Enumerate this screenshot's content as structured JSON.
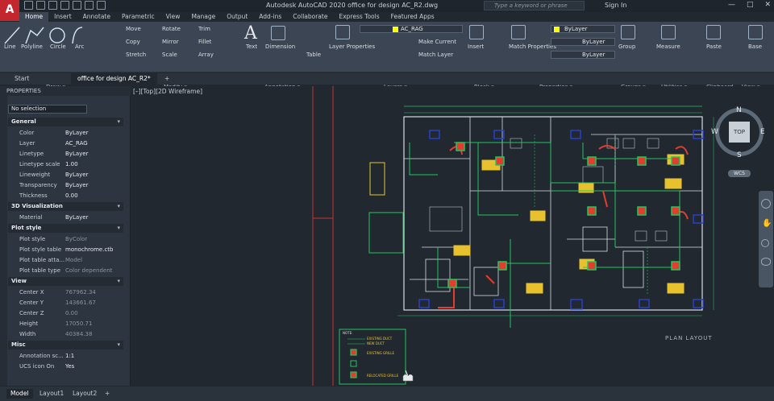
{
  "window": {
    "title": "Autodesk AutoCAD 2020   office for design AC_R2.dwg",
    "search_placeholder": "Type a keyword or phrase",
    "sign_in": "Sign In",
    "app_letter": "A",
    "controls": [
      "—",
      "□",
      "✕"
    ]
  },
  "menu_tabs": [
    "Home",
    "Insert",
    "Annotate",
    "Parametric",
    "View",
    "Manage",
    "Output",
    "Add-ins",
    "Collaborate",
    "Express Tools",
    "Featured Apps"
  ],
  "ribbon": {
    "draw": {
      "items": [
        "Line",
        "Polyline",
        "Circle",
        "Arc"
      ],
      "label": "Draw ▾"
    },
    "modify": {
      "items": [
        "Move",
        "Rotate",
        "Trim",
        "Copy",
        "Mirror",
        "Fillet",
        "Stretch",
        "Scale",
        "Array"
      ],
      "label": "Modify ▾"
    },
    "annotation": {
      "items": [
        "Text",
        "Dimension",
        "Table"
      ],
      "label": "Annotation ▾"
    },
    "layers": {
      "current_layer": "AC_RAG",
      "items": [
        "Layer Properties",
        "Make Current",
        "Match Layer"
      ],
      "label": "Layers ▾"
    },
    "block": {
      "items": [
        "Insert"
      ],
      "label": "Block ▾"
    },
    "properties": {
      "color": "ByLayer",
      "linetype": "ByLayer",
      "lineweight": "ByLayer",
      "items": [
        "Match Properties"
      ],
      "label": "Properties ▾"
    },
    "groups": {
      "items": [
        "Group"
      ],
      "label": "Groups ▾"
    },
    "utilities": {
      "items": [
        "Measure"
      ],
      "label": "Utilities ▾"
    },
    "clipboard": {
      "items": [
        "Paste"
      ],
      "label": "Clipboard"
    },
    "view": {
      "items": [
        "Base"
      ],
      "label": "View ▾"
    }
  },
  "doc_tabs": [
    "Start",
    "office for design AC_R2*",
    "+"
  ],
  "properties_panel": {
    "title": "PROPERTIES",
    "selection": "No selection",
    "sections": [
      {
        "name": "General",
        "rows": [
          [
            "Color",
            "ByLayer"
          ],
          [
            "Layer",
            "AC_RAG"
          ],
          [
            "Linetype",
            "ByLayer"
          ],
          [
            "Linetype scale",
            "1.00"
          ],
          [
            "Lineweight",
            "ByLayer"
          ],
          [
            "Transparency",
            "ByLayer"
          ],
          [
            "Thickness",
            "0.00"
          ]
        ]
      },
      {
        "name": "3D Visualization",
        "rows": [
          [
            "Material",
            "ByLayer"
          ]
        ]
      },
      {
        "name": "Plot style",
        "rows": [
          [
            "Plot style",
            "ByColor"
          ],
          [
            "Plot style table",
            "monochrome.ctb"
          ],
          [
            "Plot table atta...",
            "Model"
          ],
          [
            "Plot table type",
            "Color dependent"
          ]
        ]
      },
      {
        "name": "View",
        "rows": [
          [
            "Center X",
            "767962.34"
          ],
          [
            "Center Y",
            "143661.67"
          ],
          [
            "Center Z",
            "0.00"
          ],
          [
            "Height",
            "17050.71"
          ],
          [
            "Width",
            "40384.38"
          ]
        ]
      },
      {
        "name": "Misc",
        "rows": [
          [
            "Annotation sc...",
            "1:1"
          ],
          [
            "UCS icon On",
            "Yes"
          ]
        ]
      }
    ]
  },
  "viewport": {
    "label": "[–][Top][2D Wireframe]",
    "compass": {
      "n": "N",
      "s": "S",
      "e": "E",
      "w": "W",
      "top": "TOP",
      "wcs": "WCS"
    },
    "plan_title": "PLAN LAYOUT",
    "legend_title": "NOTE:",
    "legend_items": [
      "EXISTING DUCT",
      "NEW DUCT",
      "EXISTING GRILLE",
      "RELOCATED GRILLE"
    ]
  },
  "layout_tabs": [
    "Model",
    "Layout1",
    "Layout2",
    "+"
  ],
  "colors": {
    "accent_red": "#c4262e",
    "drawing_green": "#22c55e",
    "drawing_yellow": "#e8c22e",
    "drawing_red": "#e23d2e",
    "drawing_blue": "#2c3fc8",
    "drawing_white": "#d8dde4"
  }
}
